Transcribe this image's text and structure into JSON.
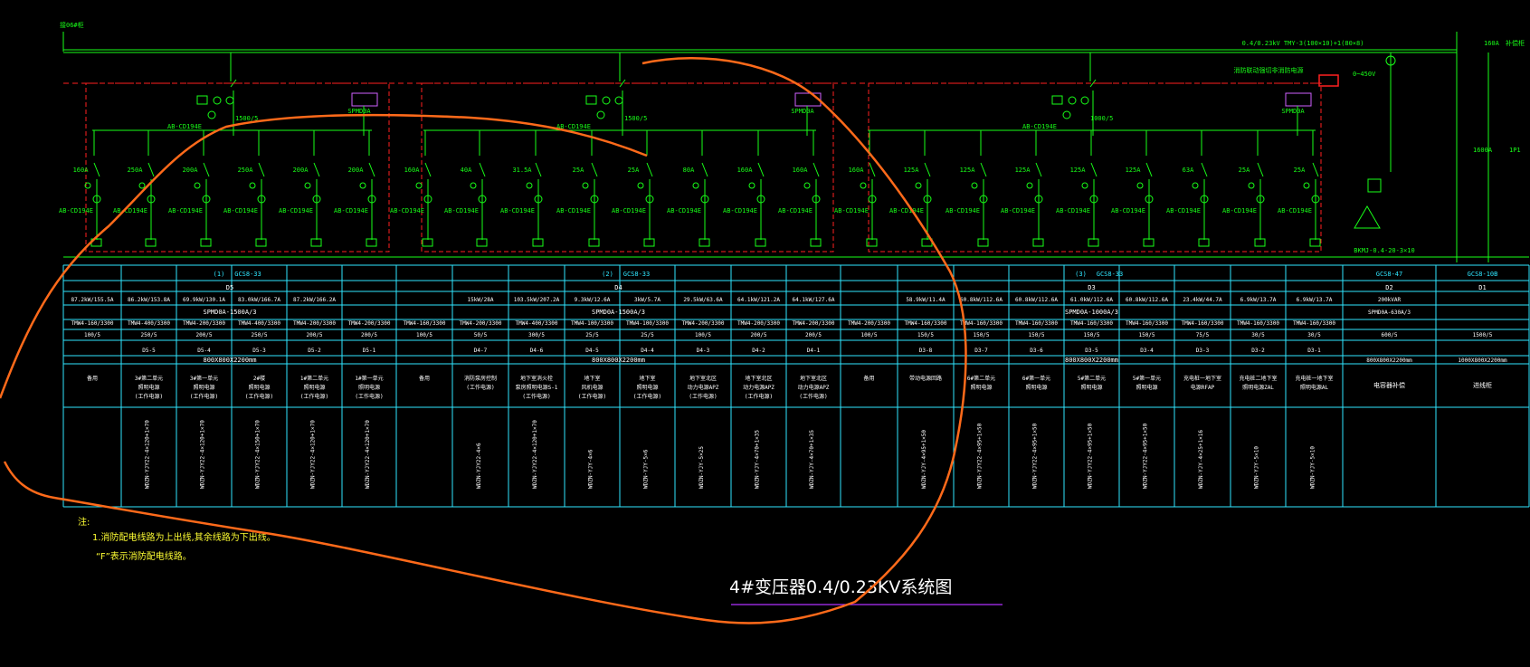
{
  "colors": {
    "background": "#000000",
    "wire": "#18ff18",
    "table_line": "#2fe6ff",
    "dashed_box": "#ff2020",
    "markup": "#ff6a1a",
    "title_underline": "#b030ff",
    "meter_box": "#d060ff",
    "note": "#ffff33"
  },
  "incoming_label": "接06#柜",
  "top_bus_label": "0.4/0.23kV  TMY-3(100×10)+1(80×8)",
  "right_top": {
    "a": "160A",
    "b": "补偿柜"
  },
  "voltmeter_label": "0~450V",
  "fire_box_label": "消防联动强切非消防电源",
  "sections": [
    {
      "ct_label": "1500/5",
      "meter_label": "AB-CD194E",
      "box": "SPMD0A",
      "breakers": [
        "160A",
        "250A",
        "200A",
        "250A",
        "200A",
        "200A"
      ],
      "group_header": "(1)",
      "cabinet_model": "GCS8-33",
      "cabinet_no": "D5",
      "powers": [
        "87.2kW/155.5A",
        "86.2kW/153.8A",
        "69.9kW/130.1A",
        "83.0kW/166.7A",
        "87.2kW/166.2A",
        ""
      ],
      "surge": "SPMD0A-1500A/3",
      "breaker_models": [
        "TMW4-160/3300",
        "TMW4-400/3300",
        "TMW4-200/3300",
        "TMW4-400/3300",
        "TMW4-200/3300",
        "TMW4-200/3300"
      ],
      "ct_ratios": [
        "100/5",
        "250/5",
        "200/5",
        "250/5",
        "200/5",
        "200/5"
      ],
      "circuit_ids": [
        "",
        "D5-5",
        "D5-4",
        "D5-3",
        "D5-2",
        "D5-1"
      ],
      "busbar": "800X800X2200mm",
      "usages": [
        "备用",
        "3#第二单元\n照明电源\n(工作电源)",
        "3#第一单元\n照明电源\n(工作电源)",
        "2#楼\n照明电源\n(工作电源)",
        "1#第二单元\n照明电源\n(工作电源)",
        "1#第一单元\n照明电源\n(工作电源)"
      ],
      "cables": [
        "",
        "WDZN-YJY22-4×120+1×70",
        "WDZN-YJY22-4×120+1×70",
        "WDZN-YJY22-4×150+1×70",
        "WDZN-YJY22-4×120+1×70",
        "WDZN-YJY22-4×120+1×70"
      ]
    },
    {
      "ct_label": "1500/5",
      "meter_label": "AB-CD194E",
      "box": "SPMD0A",
      "breakers": [
        "160A",
        "40A",
        "31.5A",
        "25A",
        "25A",
        "80A",
        "160A",
        "160A"
      ],
      "group_header": "(2)",
      "cabinet_model": "GCS8-33",
      "cabinet_no": "D4",
      "powers": [
        "",
        "15kW/28A",
        "103.5kW/207.2A",
        "9.3kW/12.6A",
        "3kW/5.7A",
        "29.5kW/63.6A",
        "64.1kW/121.2A",
        "64.1kW/127.6A"
      ],
      "surge": "SPMD0A-1500A/3",
      "breaker_models": [
        "TMW4-160/3300",
        "TMW4-200/3300",
        "TMW4-400/3300",
        "TMW4-100/3300",
        "TMW4-100/3300",
        "TMW4-200/3300",
        "TMW4-200/3300",
        "TMW4-200/3300"
      ],
      "ct_ratios": [
        "100/5",
        "50/5",
        "300/5",
        "25/5",
        "25/5",
        "100/5",
        "200/5",
        "200/5"
      ],
      "circuit_ids": [
        "",
        "D4-7",
        "D4-6",
        "D4-5",
        "D4-4",
        "D4-3",
        "D4-2",
        "D4-1"
      ],
      "busbar": "800X800X2200mm",
      "usages": [
        "备用",
        "消防泵房控制\n(工作电源)",
        "地下室消火栓\n泵房照明电源S-1\n(工作电源)",
        "地下室\n风机电源\n(工作电源)",
        "地下室\n照明电源\n(工作电源)",
        "地下室北区\n动力电源APZ\n(工作电源)",
        "地下室北区\n动力电源APZ\n(工作电源)",
        "地下室北区\n动力电源APZ\n(工作电源)"
      ],
      "cables": [
        "",
        "WDZN-YJY22-4×6",
        "WDZN-YJY22-4×120+1×70",
        "WDZN-YJY-4×6",
        "WDZN-YJY-5×6",
        "WDZN-YJY-5×25",
        "WDZN-YJY-4×70+1×35",
        "WDZN-YJY-4×70+1×35"
      ]
    },
    {
      "ct_label": "1000/5",
      "meter_label": "AB-CD194E",
      "box": "SPMD0A",
      "breakers": [
        "160A",
        "125A",
        "125A",
        "125A",
        "125A",
        "125A",
        "63A",
        "25A",
        "25A"
      ],
      "group_header": "(3)",
      "cabinet_model": "GCS8-33",
      "cabinet_no": "D3",
      "powers": [
        "",
        "58.9kW/11.4A",
        "60.8kW/112.6A",
        "60.8kW/112.6A",
        "61.0kW/112.6A",
        "60.8kW/112.6A",
        "23.4kW/44.7A",
        "6.9kW/13.7A",
        "6.9kW/13.7A"
      ],
      "surge": "SPMD0A-1000A/3",
      "breaker_models": [
        "TMW4-200/3300",
        "TMW4-160/3300",
        "TMW4-160/3300",
        "TMW4-160/3300",
        "TMW4-160/3300",
        "TMW4-160/3300",
        "TMW4-160/3300",
        "TMW4-160/3300",
        "TMW4-160/3300"
      ],
      "ct_ratios": [
        "100/5",
        "150/5",
        "150/5",
        "150/5",
        "150/5",
        "150/5",
        "75/5",
        "30/5",
        "30/5"
      ],
      "circuit_ids": [
        "",
        "D3-8",
        "D3-7",
        "D3-6",
        "D3-5",
        "D3-4",
        "D3-3",
        "D3-2",
        "D3-1"
      ],
      "busbar": "800X800X2200mm",
      "usages": [
        "备用",
        "带动电源回路",
        "6#第二单元\n照明电源",
        "6#第一单元\n照明电源",
        "5#第二单元\n照明电源",
        "5#第一单元\n照明电源",
        "充电桩一地下室\n电源RFAP",
        "充电桩二地下室\n照明电源ZAL",
        "充电桩一地下室\n照明电源AL"
      ],
      "cables": [
        "",
        "WDZN-YJY-4×95+1×50",
        "WDZN-YJY22-4×95+1×50",
        "WDZN-YJY22-4×95+1×50",
        "WDZN-YJY22-4×95+1×50",
        "WDZN-YJY22-4×95+1×50",
        "WDZN-YJY-4×25+1×16",
        "WDZN-YJY-5×10",
        "WDZN-YJY-5×10"
      ]
    }
  ],
  "extra_columns": [
    {
      "model": "GCS8-47",
      "no": "D2",
      "power": "200kVAR",
      "surge": "SPMD0A-630A/3",
      "ratio": "600/5",
      "busbar": "800X800X2200mm",
      "usage": "电容器补偿"
    },
    {
      "model": "GCS8-10B",
      "no": "D1",
      "power": "",
      "surge": "",
      "ratio": "1500/5",
      "busbar": "1000X800X2200mm",
      "usage": "进线柜"
    }
  ],
  "capacitor_label": "BKMJ-0.4-20-3×10",
  "right_edge_labels": [
    "1600A",
    "1P1",
    "SPD-B"
  ],
  "notes": {
    "head": "注:",
    "line1": "1.消防配电线路为上出线,其余线路为下出线。",
    "line2": "“F”表示消防配电线路。"
  },
  "title": "4#变压器0.4/0.23KV系统图"
}
